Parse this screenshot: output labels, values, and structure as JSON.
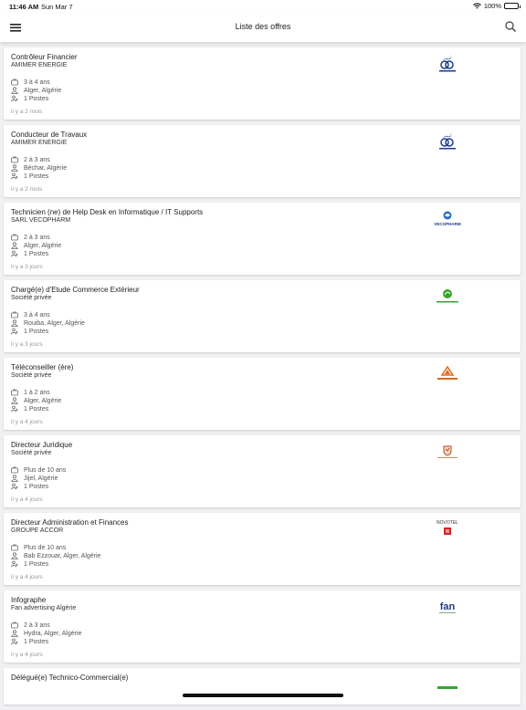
{
  "status": {
    "time": "11:46 AM",
    "date": "Sun Mar 7",
    "battery": "100%"
  },
  "header": {
    "title": "Liste des offres"
  },
  "offers": [
    {
      "title": "Contrôleur Financier",
      "company": "AMIMER ENERGIE",
      "experience": "3 à 4 ans",
      "location": "Alger, Algérie",
      "positions": "1 Postes",
      "posted": "il y a 2 mois",
      "logo": "amimer-logo"
    },
    {
      "title": "Conducteur de Travaux",
      "company": "AMIMER ENERGIE",
      "experience": "2 à 3 ans",
      "location": "Béchar, Algérie",
      "positions": "1 Postes",
      "posted": "il y a 2 mois",
      "logo": "amimer-logo"
    },
    {
      "title": "Technicien (ne) de Help Desk en Informatique / IT Supports",
      "company": "SARL VECOPHARM",
      "experience": "2 à 3 ans",
      "location": "Alger, Algérie",
      "positions": "1 Postes",
      "posted": "il y a 3 jours",
      "logo": "vecopharm-logo"
    },
    {
      "title": "Chargé(e) d'Etude Commerce Extérieur",
      "company": "Société privée",
      "experience": "3 à 4 ans",
      "location": "Rouiba, Alger, Algérie",
      "positions": "1 Postes",
      "posted": "il y a 3 jours",
      "logo": "green-leaf-logo"
    },
    {
      "title": "Téléconseiller (ère)",
      "company": "Société privée",
      "experience": "1 à 2 ans",
      "location": "Alger, Algérie",
      "positions": "1 Postes",
      "posted": "il y a 4 jours",
      "logo": "orange-triangle-logo"
    },
    {
      "title": "Directeur Juridique",
      "company": "Société privée",
      "experience": "Plus de 10 ans",
      "location": "Jijel, Algérie",
      "positions": "1 Postes",
      "posted": "il y a 4 jours",
      "logo": "shield-logo"
    },
    {
      "title": "Directeur Administration et Finances",
      "company": "GROUPE ACCOR",
      "experience": "Plus de 10 ans",
      "location": "Bab Ezzouar, Alger, Algérie",
      "positions": "1 Postes",
      "posted": "il y a 4 jours",
      "logo": "novotel-logo"
    },
    {
      "title": "Infographe",
      "company": "Fan advertising Algérie",
      "experience": "2 à 3 ans",
      "location": "Hydra, Alger, Algérie",
      "positions": "1 Postes",
      "posted": "il y a 4 jours",
      "logo": "fan-logo"
    },
    {
      "title": "Délégué(e) Technico-Commercial(e)",
      "company": "",
      "experience": "",
      "location": "",
      "positions": "",
      "posted": "",
      "logo": "green-text-logo"
    }
  ],
  "logo_text": {
    "vecopharm": "VECOPHARM",
    "novotel": "NOVOTEL",
    "fan": "fan"
  },
  "colors": {
    "accent": "#1b3a8a",
    "vecopharm": "#2b6cc4",
    "green": "#3aa335",
    "orange": "#e06a1b",
    "novotel_red": "#d2232a"
  }
}
